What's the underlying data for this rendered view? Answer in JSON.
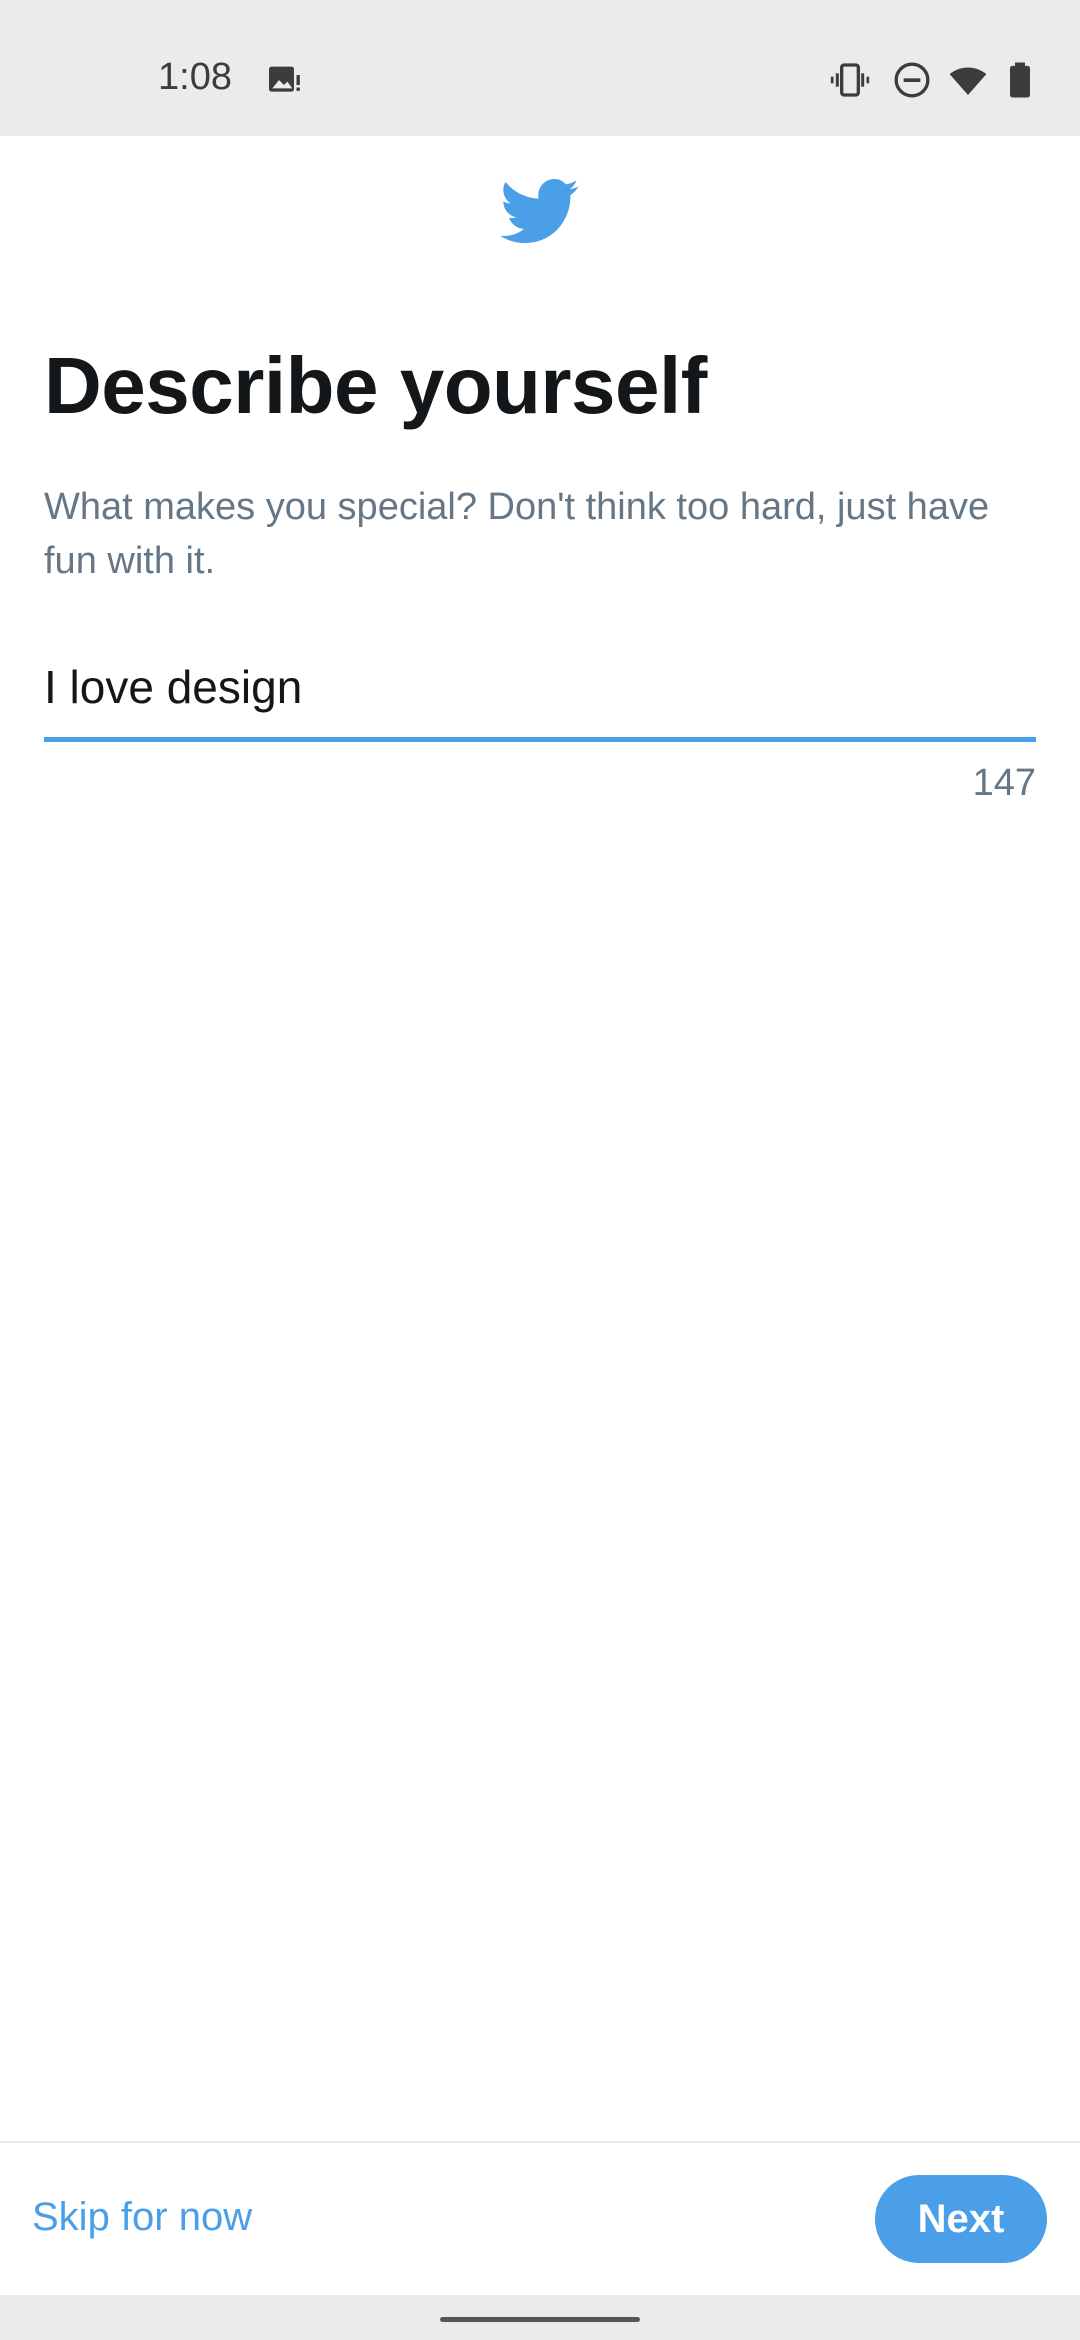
{
  "status_bar": {
    "time": "1:08",
    "icons": [
      "image-notification-icon",
      "vibrate-icon",
      "do-not-disturb-icon",
      "wifi-icon",
      "battery-icon"
    ]
  },
  "app": {
    "logo": "twitter-bird-icon",
    "accent_color": "#4a9fe8"
  },
  "page": {
    "title": "Describe yourself",
    "subtitle": "What makes you special? Don't think too hard, just have fun with it."
  },
  "bio": {
    "value": "I love design",
    "remaining_chars": "147"
  },
  "footer": {
    "skip_label": "Skip for now",
    "next_label": "Next"
  }
}
